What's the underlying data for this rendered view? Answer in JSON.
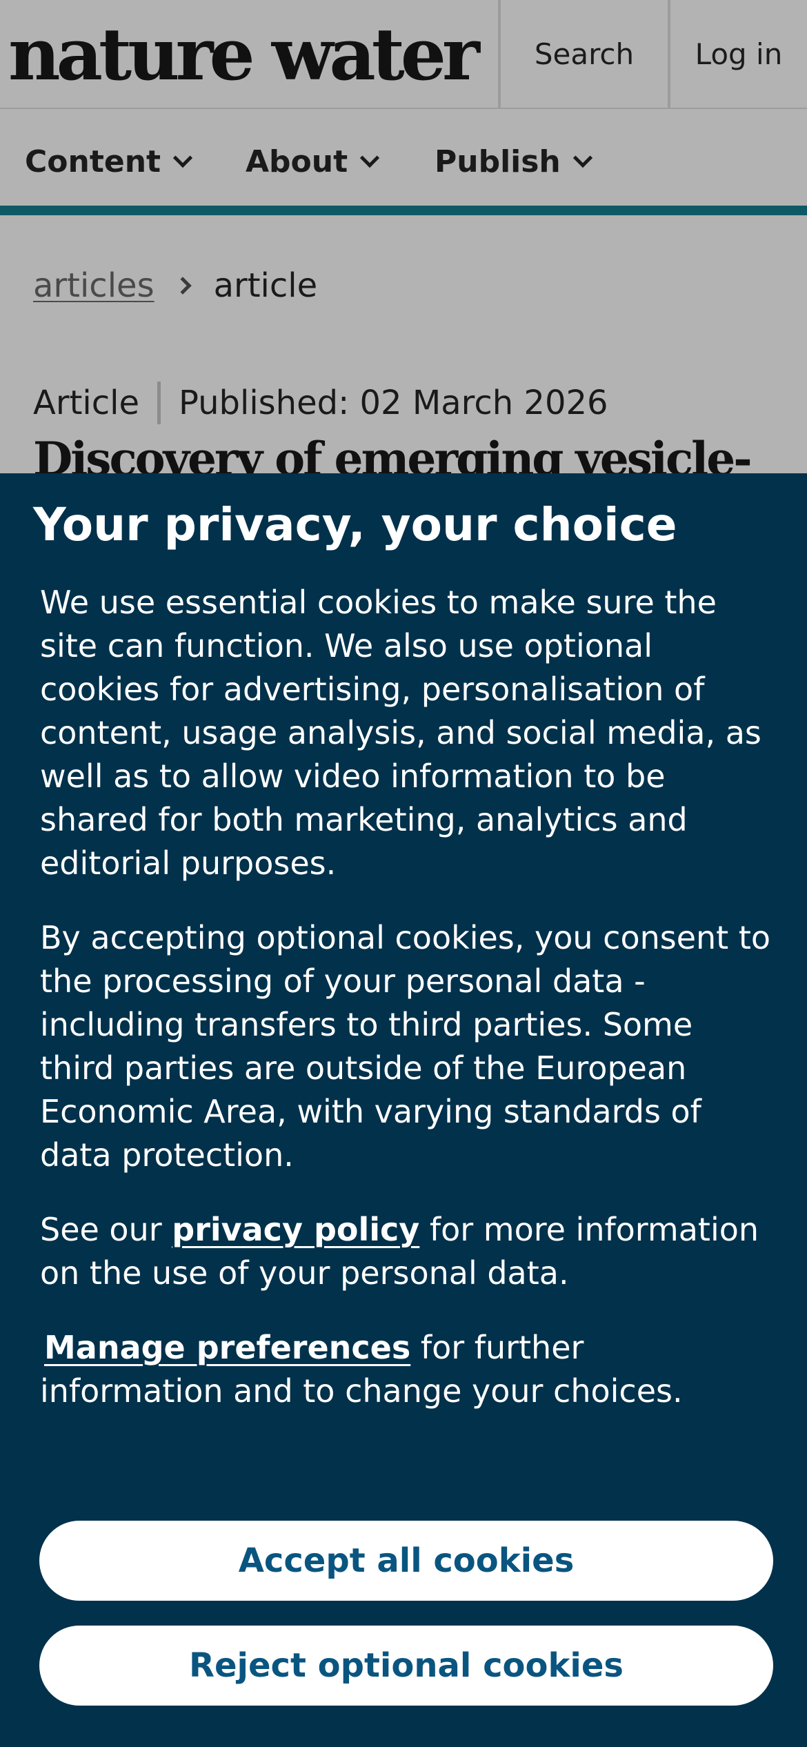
{
  "header": {
    "logo": "nature water",
    "search_label": "Search",
    "login_label": "Log in"
  },
  "nav": {
    "items": [
      {
        "label": "Content"
      },
      {
        "label": "About"
      },
      {
        "label": "Publish"
      }
    ]
  },
  "breadcrumb": {
    "link_label": "articles",
    "current_label": "article"
  },
  "article": {
    "type_label": "Article",
    "published_label": "Published: 02 March 2026",
    "title_partial": "Discovery of emerging vesicle-"
  },
  "consent": {
    "title": "Your privacy, your choice",
    "paragraph1": "We use essential cookies to make sure the site can function. We also use optional cookies for advertising, personalisation of content, usage analysis, and social media, as well as to allow video information to be shared for both marketing, analytics and editorial purposes.",
    "paragraph2": "By accepting optional cookies, you consent to the processing of your personal data - including transfers to third parties. Some third parties are outside of the European Economic Area, with varying standards of data protection.",
    "paragraph3_prefix": "See our ",
    "privacy_link": "privacy policy",
    "paragraph3_suffix": " for more information on the use of your personal data.",
    "manage_link": "Manage preferences",
    "paragraph4_suffix": " for further information and to change your choices.",
    "accept_label": "Accept all cookies",
    "reject_label": "Reject optional cookies"
  },
  "colors": {
    "consent_background": "#02314b",
    "button_text": "#0a5580",
    "nav_accent": "#0d5a66",
    "dimmed_page": "#b3b3b3"
  }
}
